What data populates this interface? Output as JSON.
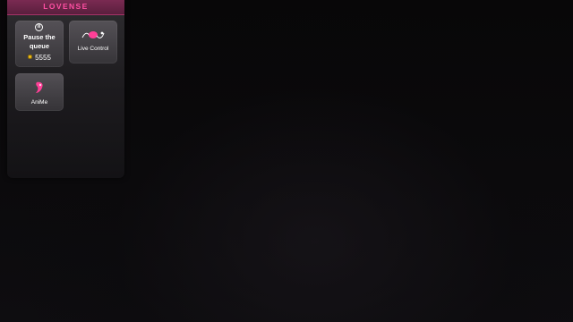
{
  "panel": {
    "brand": "LOVENSE"
  },
  "tiles": {
    "pause": {
      "label": "Pause the\nqueue",
      "coins": "5555",
      "icon": "pause-circle-icon"
    },
    "live": {
      "label": "Live Control",
      "icon": "live-control-toy-icon"
    },
    "anime": {
      "label": "AniMe",
      "icon": "anime-toy-icon"
    }
  },
  "colors": {
    "brand_pink": "#ff4fa3",
    "coin_gold": "#f2c01b",
    "background": "#050505"
  }
}
